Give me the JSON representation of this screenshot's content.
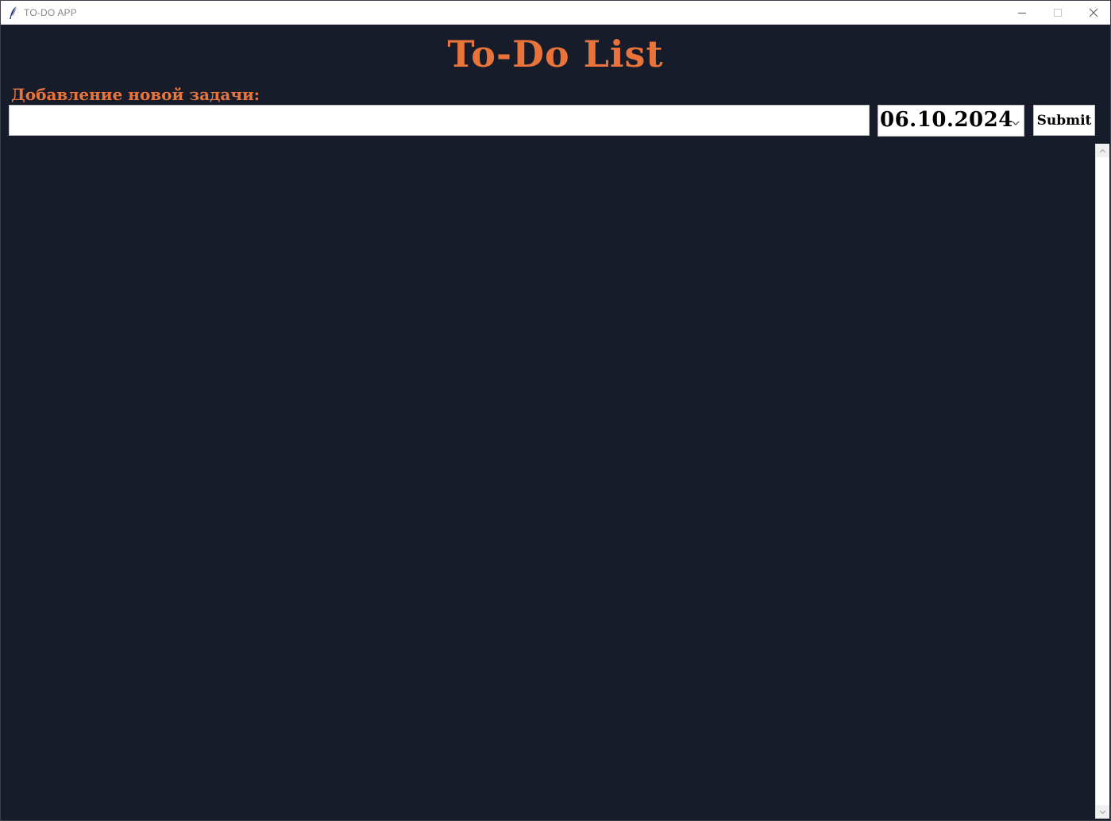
{
  "window": {
    "title": "TO-DO APP",
    "icon": "feather-icon",
    "controls": [
      "minimize-icon",
      "maximize-icon",
      "close-icon"
    ]
  },
  "header": {
    "title": "To-Do List"
  },
  "form": {
    "label": "Добавление новой задачи:",
    "task_value": "",
    "date_value": "06.10.2024",
    "submit_label": "Submit"
  },
  "task_list": {
    "items": []
  },
  "colors": {
    "background": "#171c2b",
    "accent": "#e8743b",
    "field": "#ffffff"
  }
}
